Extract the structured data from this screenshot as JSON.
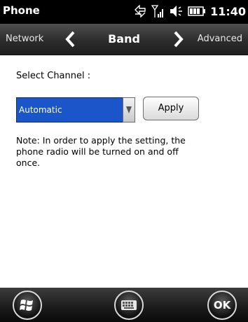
{
  "statusbar": {
    "title": "Phone",
    "time": "11:40"
  },
  "navbar": {
    "prev_label": "Network",
    "title": "Band",
    "next_label": "Advanced"
  },
  "main": {
    "select_label": "Select Channel :",
    "channel_select": {
      "value": "Automatic"
    },
    "apply_label": "Apply",
    "note": "Note: In order to apply the setting, the phone radio will be turned on and off once."
  },
  "bottombar": {
    "ok_label": "OK"
  },
  "colors": {
    "selection": "#1a55c9",
    "bar": "#000000"
  }
}
